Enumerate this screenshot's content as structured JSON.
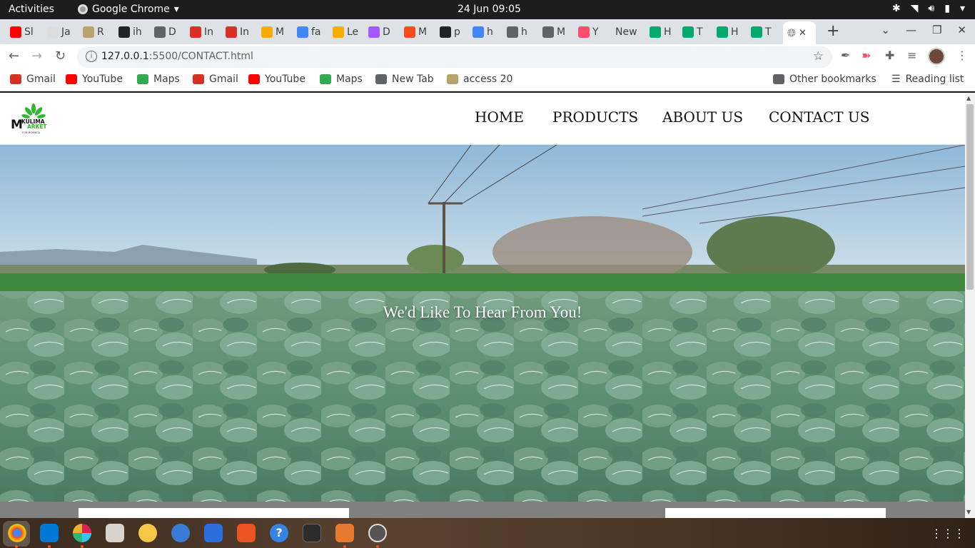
{
  "system": {
    "activities": "Activities",
    "app_name": "Google Chrome",
    "clock": "24 Jun  09:05"
  },
  "tabs": [
    {
      "label": "Sl",
      "color": "#ff0000"
    },
    {
      "label": "Ja",
      "color": "#dddddd"
    },
    {
      "label": "R",
      "color": "#b8a36a"
    },
    {
      "label": "ih",
      "color": "#202124"
    },
    {
      "label": "D",
      "color": "#5f6368"
    },
    {
      "label": "In",
      "color": "#d93025"
    },
    {
      "label": "In",
      "color": "#d93025"
    },
    {
      "label": "M",
      "color": "#f9ab00"
    },
    {
      "label": "fa",
      "color": "#4285f4"
    },
    {
      "label": "Le",
      "color": "#f9ab00"
    },
    {
      "label": "D",
      "color": "#a259ff"
    },
    {
      "label": "M",
      "color": "#f24e1e"
    },
    {
      "label": "p",
      "color": "#202124"
    },
    {
      "label": "h",
      "color": "#4285f4"
    },
    {
      "label": "h",
      "color": "#5f6368"
    },
    {
      "label": "M",
      "color": "#5f6368"
    },
    {
      "label": "Y",
      "color": "#ff4e6a"
    },
    {
      "label": "New",
      "color": ""
    },
    {
      "label": "H",
      "color": "#04aa6d"
    },
    {
      "label": "T",
      "color": "#04aa6d"
    },
    {
      "label": "H",
      "color": "#04aa6d"
    },
    {
      "label": "T",
      "color": "#04aa6d"
    }
  ],
  "active_tab": {
    "close": "✕"
  },
  "address": {
    "host": "127.0.0.1",
    "path": ":5500/CONTACT.html"
  },
  "bookmarks": [
    {
      "label": "Gmail",
      "color": "#d93025"
    },
    {
      "label": "YouTube",
      "color": "#ff0000"
    },
    {
      "label": "Maps",
      "color": "#34a853"
    },
    {
      "label": "Gmail",
      "color": "#d93025"
    },
    {
      "label": "YouTube",
      "color": "#ff0000"
    },
    {
      "label": "Maps",
      "color": "#34a853"
    },
    {
      "label": "New Tab",
      "color": "#5f6368"
    },
    {
      "label": "access 20",
      "color": "#b8a36a"
    }
  ],
  "bookmarks_right": {
    "other": "Other bookmarks",
    "reading": "Reading list"
  },
  "site": {
    "logo_text_1": "KULIMA",
    "logo_text_2": "ARKET",
    "logo_letter": "M",
    "logo_tag": "FOR MORINGA",
    "nav": [
      "HOME",
      "PRODUCTS",
      "ABOUT US",
      "CONTACT US"
    ],
    "hero_title": "We'd Like To Hear From You!"
  }
}
